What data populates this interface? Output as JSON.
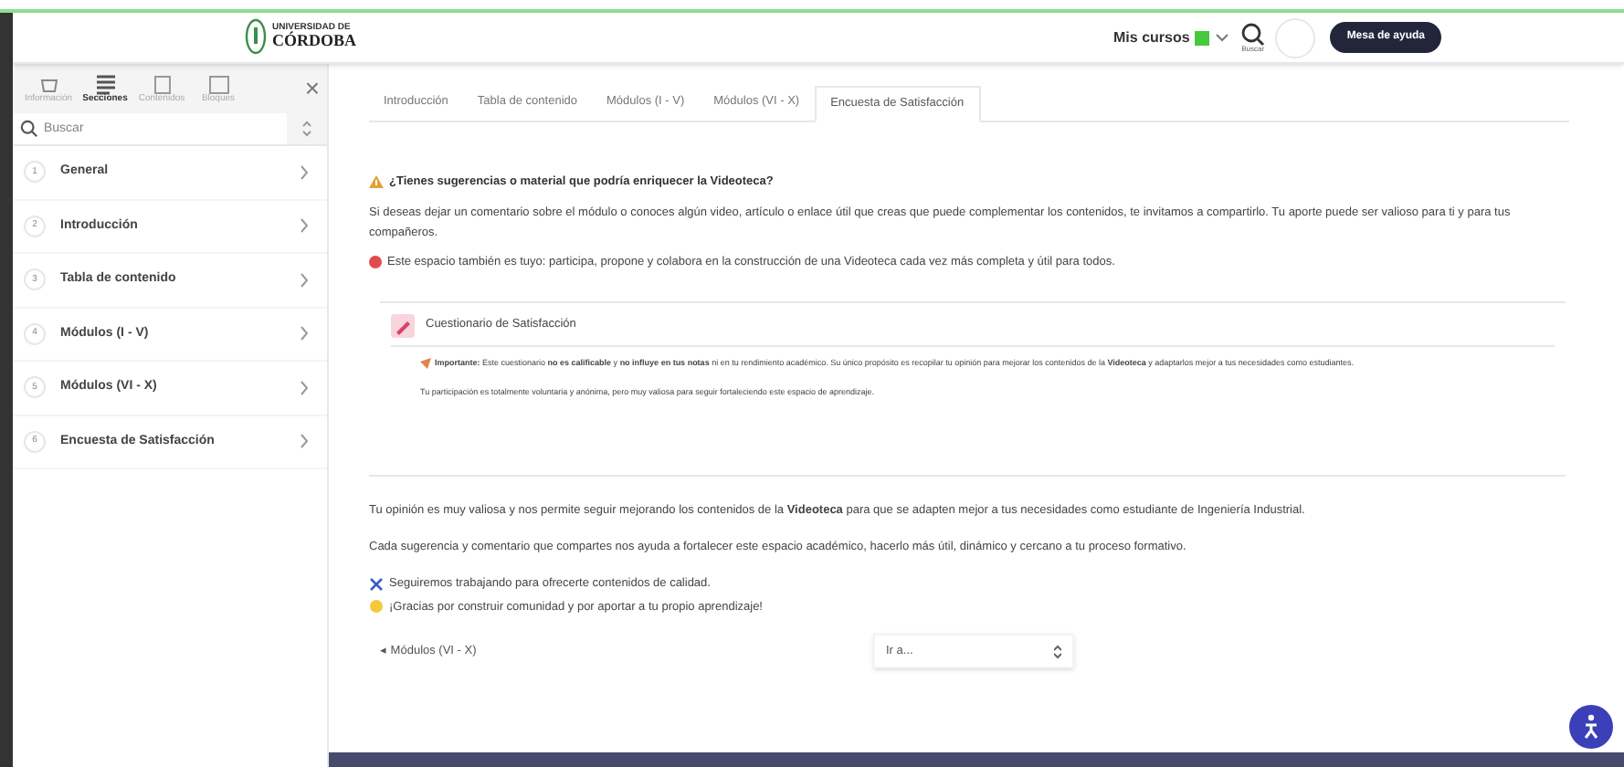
{
  "header": {
    "logo_line1": "UNIVERSIDAD DE",
    "logo_line2": "CÓRDOBA",
    "my_courses": "Mis cursos",
    "search_label": "Buscar",
    "help_button": "Mesa de ayuda"
  },
  "sidebar": {
    "tabs": [
      {
        "label": "Información",
        "selected": false
      },
      {
        "label": "Secciones",
        "selected": true
      },
      {
        "label": "Contenidos",
        "selected": false
      },
      {
        "label": "Bloques",
        "selected": false
      }
    ],
    "close": "×",
    "search_placeholder": "Buscar",
    "items": [
      {
        "number": "1",
        "label": "General"
      },
      {
        "number": "2",
        "label": "Introducción"
      },
      {
        "number": "3",
        "label": "Tabla de contenido"
      },
      {
        "number": "4",
        "label": "Módulos (I - V)"
      },
      {
        "number": "5",
        "label": "Módulos (VI - X)"
      },
      {
        "number": "6",
        "label": "Encuesta de Satisfacción"
      }
    ]
  },
  "tabs": [
    {
      "label": "Introducción",
      "selected": false
    },
    {
      "label": "Tabla de contenido",
      "selected": false
    },
    {
      "label": "Módulos (I - V)",
      "selected": false
    },
    {
      "label": "Módulos (VI - X)",
      "selected": false
    },
    {
      "label": "Encuesta de Satisfacción",
      "selected": true
    }
  ],
  "content": {
    "heading": "¿Tienes sugerencias o material que podría enriquecer la Videoteca?",
    "intro": "Si deseas dejar un comentario sobre el módulo o conoces algún video, artículo o enlace útil que creas que puede complementar los contenidos, te invitamos a compartirlo. Tu aporte puede ser valioso para ti y para tus compañeros.",
    "invite": "Este espacio también es tuyo: participa, propone y colabora en la construcción de una Videoteca cada vez más completa y útil para todos.",
    "quiz_title": "Cuestionario de Satisfacción",
    "quiz_note": "**Importante:** Este cuestionario **no es calificable** y **no influye en tus notas** ni en tu rendimiento académico. Su único propósito es recopilar tu opinión para mejorar los contenidos de la **Videoteca** y adaptarlos mejor a tus necesidades como estudiantes.",
    "quiz_note2": "Tu participación es totalmente voluntaria y anónima, pero muy valiosa para seguir fortaleciendo este espacio de aprendizaje.",
    "closing1": "Tu opinión es muy valiosa y nos permite seguir mejorando los contenidos de la **Videoteca** para que se adapten mejor a tus necesidades como estudiante de Ingeniería Industrial.",
    "closing2": "Cada sugerencia y comentario que compartes nos ayuda a fortalecer este espacio académico, hacerlo más útil, dinámico y cercano a tu proceso formativo.",
    "closing3": "Seguiremos trabajando para ofrecerte contenidos de calidad.",
    "closing4": "¡Gracias por construir comunidad y por aportar a tu propio aprendizaje!",
    "prev_link": "◂ Módulos (VI - X)",
    "jump_select": "Ir a..."
  }
}
